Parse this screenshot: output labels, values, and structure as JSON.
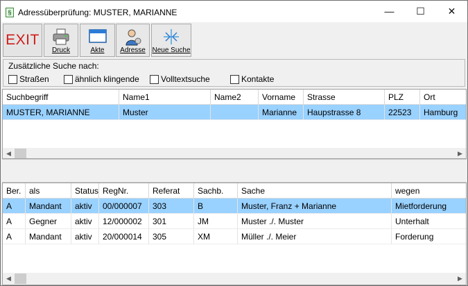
{
  "window": {
    "title": "Adressüberprüfung: MUSTER, MARIANNE",
    "minimize": "—",
    "maximize": "☐",
    "close": "✕"
  },
  "toolbar": {
    "exit": "EXIT",
    "druck": "Druck",
    "akte": "Akte",
    "adresse": "Adresse",
    "neue_suche": "Neue Suche"
  },
  "search": {
    "title": "Zusätzliche Suche nach:",
    "options": [
      {
        "label": "Straßen",
        "checked": false
      },
      {
        "label": "ähnlich klingende",
        "checked": false
      },
      {
        "label": "Volltextsuche",
        "checked": false
      },
      {
        "label": "Kontakte",
        "checked": false
      }
    ]
  },
  "address_table": {
    "headers": [
      "Suchbegriff",
      "Name1",
      "Name2",
      "Vorname",
      "Strasse",
      "PLZ",
      "Ort"
    ],
    "rows": [
      [
        "MUSTER, MARIANNE",
        "Muster",
        "",
        "Marianne",
        "Haupstrasse 8",
        "22523",
        "Hamburg"
      ]
    ]
  },
  "case_table": {
    "headers": [
      "Ber.",
      "als",
      "Status",
      "RegNr.",
      "Referat",
      "Sachb.",
      "Sache",
      "wegen"
    ],
    "rows": [
      [
        "A",
        "Mandant",
        "aktiv",
        "00/000007",
        "303",
        "B",
        "Muster, Franz + Marianne",
        "Mietforderung"
      ],
      [
        "A",
        "Gegner",
        "aktiv",
        "12/000002",
        "301",
        "JM",
        "Muster ./. Muster",
        "Unterhalt"
      ],
      [
        "A",
        "Mandant",
        "aktiv",
        "20/000014",
        "305",
        "XM",
        "Müller ./. Meier",
        "Forderung"
      ]
    ]
  },
  "scroll": {
    "left": "◀",
    "right": "▶"
  },
  "colors": {
    "selection": "#99d1ff",
    "exit_red": "#d11a1a"
  }
}
